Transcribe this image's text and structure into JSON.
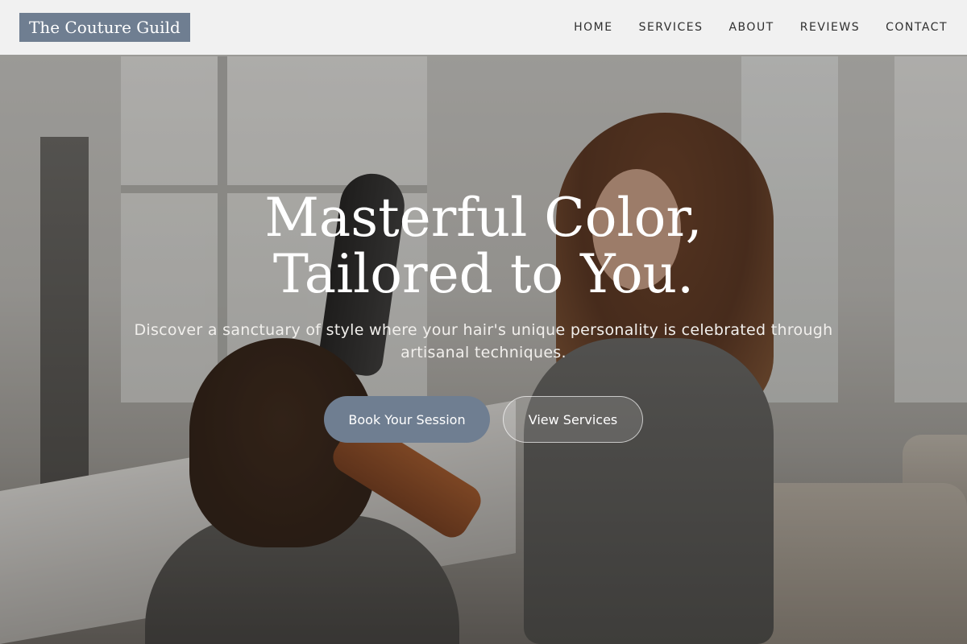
{
  "header": {
    "brand": "The Couture Guild",
    "nav": [
      {
        "label": "HOME"
      },
      {
        "label": "SERVICES"
      },
      {
        "label": "ABOUT"
      },
      {
        "label": "REVIEWS"
      },
      {
        "label": "CONTACT"
      }
    ]
  },
  "hero": {
    "headline_line1": "Masterful Color,",
    "headline_line2": "Tailored to You.",
    "subtitle": "Discover a sanctuary of style where your hair's unique personality is celebrated through artisanal techniques.",
    "primary_cta": "Book Your Session",
    "secondary_cta": "View Services"
  },
  "colors": {
    "accent": "#6f7e91",
    "header_bg": "#f8f8f7",
    "text_dark": "#2f2f2f"
  }
}
